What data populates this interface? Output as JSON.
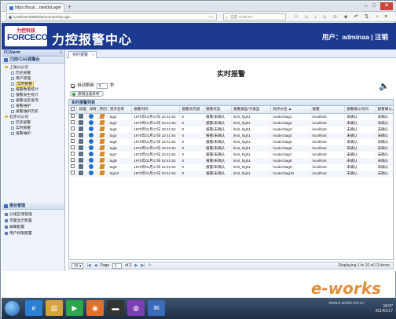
{
  "browser": {
    "tab_title": "https://local....ntel/doLogin",
    "new_tab": "+",
    "window_buttons": [
      "–",
      "□",
      "✕"
    ],
    "url": "localhost:8080/alarmcenter/doLogin",
    "url_right": "▿ C",
    "search_placeholder": "百度 <Ctrl+K>",
    "nav_icons": [
      "☆",
      "⌂",
      "↓",
      "⌂",
      "☺",
      "◈",
      "↶",
      "⇅",
      "◔",
      "≡"
    ]
  },
  "app": {
    "logo_cn": "力控科技",
    "logo_en": "FORCECON",
    "title": "力控报警中心",
    "user_label": "用户：adminaa",
    "logout": "注销",
    "separator": "|"
  },
  "sidebar": {
    "header": "FCAlarm",
    "collapse": "«",
    "section1": "力控FCAE报警台",
    "tree": [
      {
        "label": "上海分公司",
        "type": "folder",
        "indent": 0
      },
      {
        "label": "历史报警",
        "type": "leaf",
        "indent": 2
      },
      {
        "label": "用户管理",
        "type": "leaf",
        "indent": 2
      },
      {
        "label": "实时报警",
        "type": "leaf",
        "indent": 2,
        "selected": true
      },
      {
        "label": "报警数量统计",
        "type": "leaf",
        "indent": 2
      },
      {
        "label": "报警发生统计",
        "type": "leaf",
        "indent": 2
      },
      {
        "label": "报警设定查询",
        "type": "leaf",
        "indent": 2
      },
      {
        "label": "报警维护",
        "type": "leaf",
        "indent": 2
      },
      {
        "label": "报警维护历史",
        "type": "leaf",
        "indent": 2
      },
      {
        "label": "北京分公司",
        "type": "folder",
        "indent": 0
      },
      {
        "label": "历史报警",
        "type": "leaf",
        "indent": 2
      },
      {
        "label": "实时报警",
        "type": "leaf",
        "indent": 2
      },
      {
        "label": "报警维护",
        "type": "leaf",
        "indent": 2
      }
    ],
    "section2": "报台管理",
    "menu": [
      "分组区域管理",
      "页面显示配置",
      "屏幕配置",
      "用户权限配置"
    ]
  },
  "content": {
    "tab_label": "实时报警",
    "tab_close": "x",
    "page_title": "实时报警",
    "auto_refresh_label": "自动刷新",
    "auto_refresh_value": "5",
    "seconds_label": "秒",
    "add_filter_label": "新增过滤条件",
    "speaker": "🔈",
    "grid_title": "实时报警列表",
    "columns": [
      "",
      "处理",
      "详情",
      "原因",
      "测点名称",
      "报警时间",
      "报警优先级",
      "报警状态",
      "报警类型/子类型",
      "测点长名 ▲",
      "报警",
      "报警确认时间",
      "报警确认人员"
    ],
    "rows": [
      [
        "tag1",
        "1970年01月17日 22:41:54",
        "0",
        "报警/未确认",
        "limit_high1",
        "\\node1\\tag1",
        "localhost",
        "未确认",
        "未确认"
      ],
      [
        "tag2",
        "1970年01月17日 22:41:54",
        "0",
        "报警/未确认",
        "limit_high1",
        "\\node1\\tag2",
        "localhost",
        "未确认",
        "未确认"
      ],
      [
        "tag3",
        "1970年01月17日 22:41:54",
        "0",
        "报警/未确认",
        "limit_high1",
        "\\node1\\tag3",
        "localhost",
        "未确认",
        "未确认"
      ],
      [
        "tag4",
        "1970年01月17日 22:41:54",
        "0",
        "报警/未确认",
        "limit_high1",
        "\\node1\\tag4",
        "localhost",
        "未确认",
        "未确认"
      ],
      [
        "tag5",
        "1970年01月17日 22:41:54",
        "0",
        "报警/未确认",
        "limit_high1",
        "\\node1\\tag5",
        "localhost",
        "未确认",
        "未确认"
      ],
      [
        "tag6",
        "1970年01月17日 22:41:54",
        "0",
        "报警/未确认",
        "limit_high1",
        "\\node1\\tag6",
        "localhost",
        "未确认",
        "未确认"
      ],
      [
        "tag7",
        "1970年01月17日 22:41:54",
        "0",
        "报警/未确认",
        "limit_high1",
        "\\node1\\tag7",
        "localhost",
        "未确认",
        "未确认"
      ],
      [
        "tag8",
        "1970年01月17日 22:41:54",
        "0",
        "报警/未确认",
        "limit_high1",
        "\\node1\\tag8",
        "localhost",
        "未确认",
        "未确认"
      ],
      [
        "tag9",
        "1970年01月17日 22:41:54",
        "0",
        "报警/未确认",
        "limit_high1",
        "\\node1\\tag9",
        "localhost",
        "未确认",
        "未确认"
      ],
      [
        "tag10",
        "1970年01月17日 22:41:54",
        "0",
        "报警/未确认",
        "limit_high1",
        "\\node1\\tag10",
        "localhost",
        "未确认",
        "未确认"
      ]
    ],
    "pager": {
      "page_size": "10 ▾",
      "first": "|◀",
      "prev": "◀",
      "page_label": "Page",
      "page_value": "1",
      "of_label": "of 2",
      "next": "▶",
      "last": "▶|",
      "refresh": "↻",
      "display": "Displaying 1 to 10 of 13 items"
    }
  },
  "taskbar": {
    "apps": [
      {
        "glyph": "e",
        "color": "#2a7fd4"
      },
      {
        "glyph": "▤",
        "color": "#d8a23a"
      },
      {
        "glyph": "▶",
        "color": "#2aa84a"
      },
      {
        "glyph": "◉",
        "color": "#e3702a"
      },
      {
        "glyph": "▬",
        "color": "#333333"
      },
      {
        "glyph": "◍",
        "color": "#7a3fb0"
      },
      {
        "glyph": "✉",
        "color": "#3a6ab8"
      }
    ],
    "tray_time": "18:07",
    "tray_date": "2014/1/17"
  },
  "watermark": "e-works",
  "watermark_sub": "www.e-works.net.cn"
}
